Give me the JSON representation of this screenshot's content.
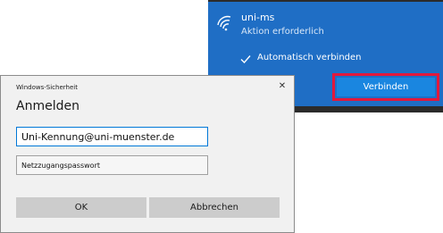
{
  "wifi_flyout": {
    "network_name": "uni-ms",
    "network_status": "Aktion erforderlich",
    "auto_connect_label": "Automatisch verbinden",
    "connect_button": "Verbinden",
    "wifi_icon": "wifi-signal-icon",
    "check_icon": "checkmark-icon",
    "colors": {
      "item_background": "#1f6ec5",
      "button_background": "#1a86e0",
      "highlight_border": "#e2183c"
    }
  },
  "dialog": {
    "caption": "Windows-Sicherheit",
    "close_icon": "close-icon",
    "close_glyph": "✕",
    "title": "Anmelden",
    "username_value": "Uni-Kennung@uni-muenster.de",
    "password_placeholder": "Netzzugangspasswort",
    "ok_button": "OK",
    "cancel_button": "Abbrechen"
  }
}
